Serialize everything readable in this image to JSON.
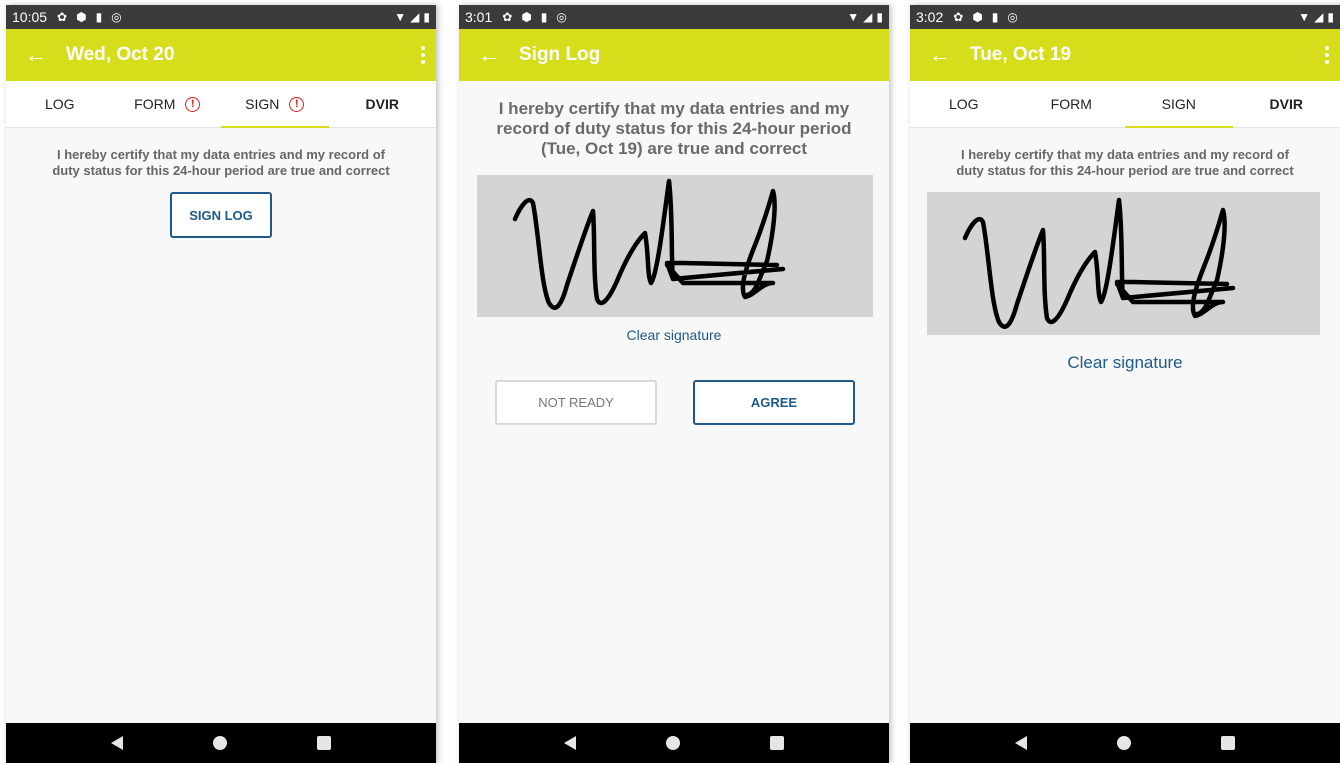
{
  "screens": [
    {
      "status_time": "10:05",
      "title": "Wed, Oct 20",
      "tabs": [
        {
          "label": "LOG"
        },
        {
          "label": "FORM"
        },
        {
          "label": "SIGN"
        },
        {
          "label": "DVIR"
        }
      ],
      "certification_line1": "I hereby certify that my data entries and my record of",
      "certification_line2": "duty status for this 24-hour period are true and correct",
      "sign_button": "SIGN LOG"
    },
    {
      "status_time": "3:01",
      "title": "Sign Log",
      "certification_line1": "I hereby certify that my data entries and my",
      "certification_line2": "record of duty status for this 24-hour period",
      "certification_line3": "(Tue, Oct 19) are true and correct",
      "clear_label": "Clear signature",
      "not_ready_label": "NOT READY",
      "agree_label": "AGREE"
    },
    {
      "status_time": "3:02",
      "title": "Tue, Oct 19",
      "tabs": [
        {
          "label": "LOG"
        },
        {
          "label": "FORM"
        },
        {
          "label": "SIGN"
        },
        {
          "label": "DVIR"
        }
      ],
      "certification_line1": "I hereby certify that my data entries and my record of",
      "certification_line2": "duty status for this 24-hour period are true and correct",
      "clear_label": "Clear signature"
    }
  ],
  "colors": {
    "app_bar": "#d6dd1b",
    "status_bar": "#3b3b3b",
    "accent_blue": "#1e5a8a",
    "alert_red": "#e01c1c",
    "signature_bg": "#d4d4d4"
  },
  "icons": {
    "status": [
      "settings-icon",
      "shield-icon",
      "sd-card-icon",
      "sync-icon",
      "wifi-icon",
      "signal-icon",
      "battery-icon"
    ],
    "app_bar": [
      "back-arrow-icon",
      "more-vert-icon"
    ],
    "nav": [
      "nav-back-icon",
      "nav-home-icon",
      "nav-recents-icon"
    ]
  }
}
